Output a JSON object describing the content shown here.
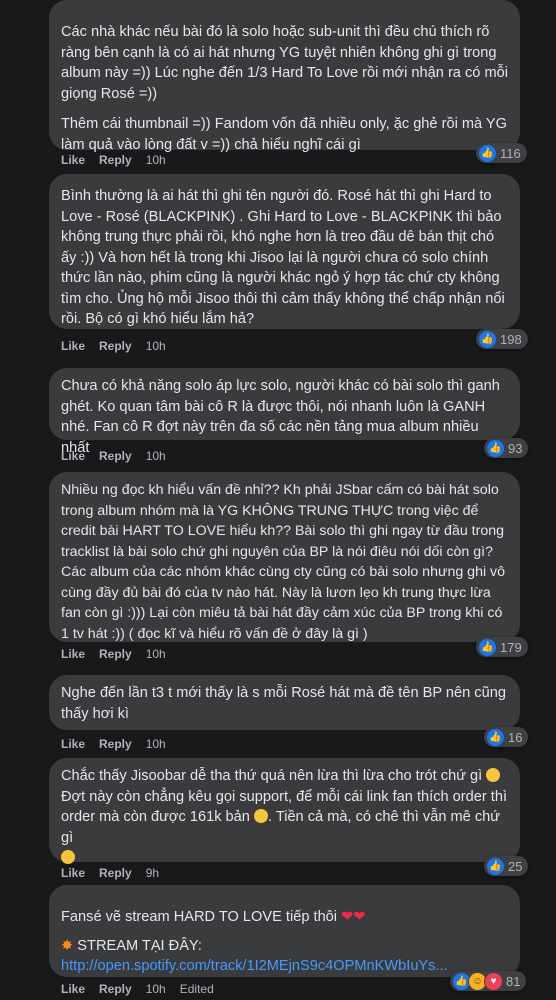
{
  "comments": [
    {
      "paragraphs": [
        "Các nhà khác nếu bài đó là solo hoặc sub-unit thì đều chú thích rõ ràng bên cạnh là có ai hát nhưng YG tuyệt nhiên không ghi gì trong album này =)) Lúc nghe đến 1/3 Hard To Love rồi mới nhận ra có mỗi giọng Rosé =))",
        "Thêm cái thumbnail =)) Fandom vốn đã nhiều only, ặc ghẻ rồi mà YG làm quả vào lòng đất v =)) chả hiểu nghĩ cái gì"
      ],
      "like": "Like",
      "reply": "Reply",
      "time": "10h",
      "reactions": "116"
    },
    {
      "paragraphs": [
        "Bình thường là ai hát thì ghi tên người đó. Rosé hát thì ghi Hard to Love - Rosé (BLACKPINK) . Ghi Hard to Love - BLACKPINK thì bảo không trung thực phải rồi, khó nghe hơn là treo đầu dê bán thịt chó ấy :)) Và hơn hết là trong khi Jisoo lại là người chưa có solo chính thức lần nào, phim cũng là người khác ngỏ ý hợp tác chứ cty không tìm cho. Ủng hộ mỗi Jisoo thôi thì cảm thấy không thể chấp nhận nổi rồi. Bộ có gì khó hiểu lắm hả?"
      ],
      "like": "Like",
      "reply": "Reply",
      "time": "10h",
      "reactions": "198"
    },
    {
      "paragraphs": [
        "Chưa có khả năng solo áp lực solo, người khác có bài solo thì ganh ghét. Ko quan tâm bài cô R là được thôi, nói nhanh luôn là GANH nhé. Fan cô R đợt này trên đa số các nền tảng mua album nhiều nhất"
      ],
      "like": "Like",
      "reply": "Reply",
      "time": "10h",
      "reactions": "93"
    },
    {
      "paragraphs": [
        "Nhiều ng đọc kh hiểu vấn đề nhỉ?? Kh phải JSbar cấm có bài hát solo trong album nhóm mà là YG KHÔNG TRUNG THỰC trong việc để credit bài HART TO LOVE hiểu kh?? Bài solo thì ghi ngay từ đầu trong tracklist là bài solo chứ ghi nguyên của BP là nói điêu nói dối còn gì? Các album của các nhóm khác cùng cty cũng có bài solo nhưng ghi vô cùng đầy đủ bài đó của tv nào hát. Này là lươn lẹo kh trung thực lừa fan còn gì :))) Lại còn miêu tả bài hát đầy cảm xúc của BP trong khi có 1 tv hát :)) ( đọc kĩ và hiểu rõ vấn đề ở đây là gì )"
      ],
      "like": "Like",
      "reply": "Reply",
      "time": "10h",
      "reactions": "179"
    },
    {
      "paragraphs": [
        "Nghe đến lần t3 t mới thấy là s mỗi Rosé hát mà đề tên BP nên cũng thấy hơi kì"
      ],
      "like": "Like",
      "reply": "Reply",
      "time": "10h",
      "reactions": "16"
    },
    {
      "paragraphs": [
        "Chắc thấy Jisoobar dễ tha thứ quá nên lừa thì lừa cho trót chứ gì",
        "Đợt này còn chẳng kêu gọi support, để mỗi cái link fan thích order thì order mà còn được 161k bản",
        "Tiền cả mà, có chê thì vẫn mê chứ gì"
      ],
      "like": "Like",
      "reply": "Reply",
      "time": "9h",
      "reactions": "25"
    },
    {
      "line1": "Fansé vẽ stream HARD TO LOVE tiếp thôi",
      "line2": "STREAM TẠI ĐÂY:",
      "link": "http://open.spotify.com/track/1I2MEjnS9c4OPMnKWbIuYs...",
      "like": "Like",
      "reply": "Reply",
      "time": "10h",
      "edited": "Edited",
      "reactions": "81"
    }
  ]
}
